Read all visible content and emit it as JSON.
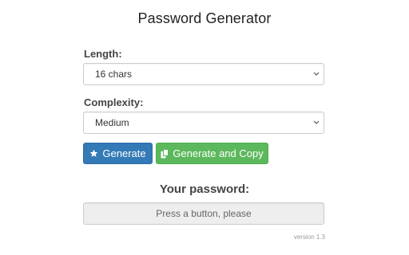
{
  "app": {
    "title": "Password Generator"
  },
  "length": {
    "label": "Length:",
    "selected": "16 chars",
    "chevron_icon": "chevron-down-icon"
  },
  "complexity": {
    "label": "Complexity:",
    "selected": "Medium",
    "chevron_icon": "chevron-down-icon"
  },
  "buttons": {
    "generate": {
      "icon": "star-icon",
      "label": "Generate",
      "color": "#337ab7"
    },
    "generate_copy": {
      "icon": "copy-icon",
      "label": "Generate and Copy",
      "color": "#5cb85c"
    }
  },
  "password": {
    "label": "Your password:",
    "placeholder": "Press a button, please"
  },
  "footer": {
    "version": "version 1.3"
  }
}
